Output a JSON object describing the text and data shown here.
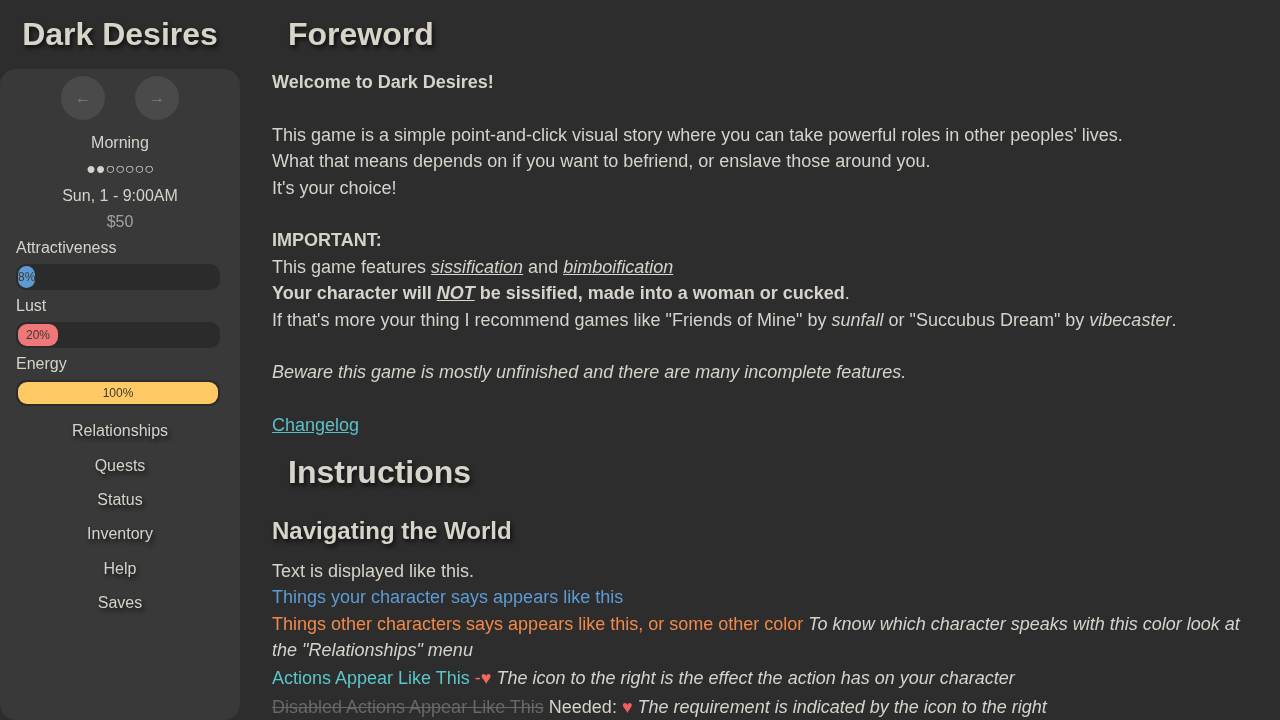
{
  "sidebar": {
    "title": "Dark Desires",
    "nav_buttons": [
      {
        "label": "←"
      },
      {
        "label": "→"
      }
    ],
    "time_of_day": "Morning",
    "day_progress": "●●○○○○○",
    "date_time": "Sun, 1 - 9:00AM",
    "money": "$50",
    "stats": [
      {
        "name": "Attractiveness",
        "level": 0.08,
        "reading": "8%",
        "color": "#5e9bd3"
      },
      {
        "name": "Lust",
        "level": 0.2,
        "reading": "20%",
        "color": "#f07777"
      },
      {
        "name": "Energy",
        "level": 1.0,
        "reading": "100%",
        "color": "#ffc966"
      }
    ],
    "menu": [
      "Relationships",
      "Quests",
      "Status",
      "Inventory",
      "Help",
      "Saves"
    ]
  },
  "foreword": {
    "title": "Foreword",
    "paragraphs": [
      [
        [
          {
            "kind": "strong",
            "text": "Welcome to Dark Desires!"
          }
        ]
      ],
      [
        [
          {
            "kind": "plain",
            "text": "This game is a simple point-and-click visual story where you can take powerful roles in other peoples' lives."
          }
        ],
        [
          {
            "kind": "plain",
            "text": "What that means depends on if you want to befriend, or enslave those around you."
          }
        ],
        [
          {
            "kind": "plain",
            "text": "It's your choice!"
          }
        ]
      ],
      [
        [
          {
            "kind": "strong",
            "text": "IMPORTANT:"
          }
        ],
        [
          {
            "kind": "plain",
            "text": "This game features "
          },
          {
            "kind": "term",
            "text": "sissification"
          },
          {
            "kind": "plain",
            "text": " and "
          },
          {
            "kind": "term",
            "text": "bimboification"
          }
        ],
        [
          {
            "kind": "strong",
            "text": "Your character will "
          },
          {
            "kind": "strong-term",
            "text": "NOT"
          },
          {
            "kind": "strong",
            "text": " be sissified, made into a woman or cucked"
          },
          {
            "kind": "plain",
            "text": "."
          }
        ],
        [
          {
            "kind": "plain",
            "text": "If that's more your thing I recommend games like \"Friends of Mine\" by *sunfall* or \"Succubus Dream\" by *vibecaster*."
          }
        ]
      ],
      [
        [
          {
            "kind": "emphasis",
            "text": "Beware this game is mostly unfinished and there are many incomplete features."
          }
        ]
      ],
      [
        [
          {
            "kind": "link",
            "text": "Changelog"
          }
        ]
      ]
    ]
  },
  "instructions": {
    "title": "Instructions",
    "subsections": [
      {
        "title": "Navigating the World",
        "lines": [
          [
            {
              "kind": "plain",
              "text": "Text is displayed like this."
            }
          ],
          [
            {
              "kind": "speech-self",
              "text": "Things your character says appears like this"
            }
          ],
          [
            {
              "kind": "speech-other",
              "text": "Things other characters says appears like this, or some other color"
            },
            {
              "kind": "hint",
              "text": " To know which character speaks with this color look at the \"Relationships\" menu"
            }
          ],
          [
            {
              "kind": "action",
              "text": "Actions Appear Like This"
            },
            {
              "kind": "effect",
              "text": " -♥"
            },
            {
              "kind": "hint",
              "text": " The icon to the right is the effect the action has on your character"
            }
          ],
          [
            {
              "kind": "disabled",
              "text": "Disabled Actions Appear Like This"
            },
            {
              "kind": "plain",
              "text": " Needed: "
            },
            {
              "kind": "requirement",
              "text": "♥"
            },
            {
              "kind": "hint",
              "text": " The requirement is indicated by the icon to the right"
            }
          ]
        ]
      }
    ]
  }
}
